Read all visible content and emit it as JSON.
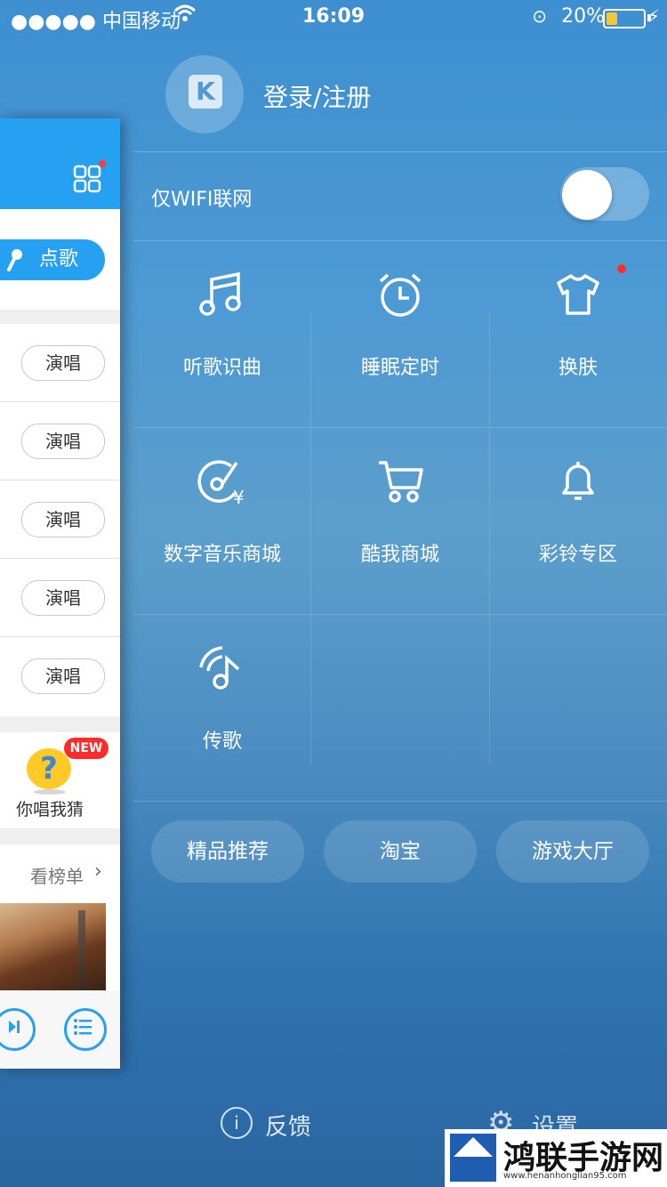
{
  "status_bar": {
    "carrier": "●●●●● 中国移动",
    "time": "16:09",
    "battery": "20%",
    "battery_color": "#f3c93a"
  },
  "header": {
    "login_label": "登录/注册",
    "avatar_letter": "K"
  },
  "wifi_only": {
    "label": "仅WIFI联网",
    "enabled": false
  },
  "grid": [
    {
      "label": "听歌识曲",
      "icon": "music-note-icon"
    },
    {
      "label": "睡眠定时",
      "icon": "alarm-clock-icon"
    },
    {
      "label": "换肤",
      "icon": "tshirt-icon",
      "badge": true
    },
    {
      "label": "数字音乐商城",
      "icon": "music-disc-yen-icon"
    },
    {
      "label": "酷我商城",
      "icon": "shopping-cart-icon"
    },
    {
      "label": "彩铃专区",
      "icon": "bell-icon"
    },
    {
      "label": "传歌",
      "icon": "wireless-music-icon"
    }
  ],
  "pills": [
    "精品推荐",
    "淘宝",
    "游戏大厅"
  ],
  "footer": {
    "feedback": "反馈",
    "settings": "设置"
  },
  "drawer": {
    "song_button": "点歌",
    "sing_label": "演唱",
    "new_badge": "NEW",
    "guess_label": "你唱我猜",
    "rank_label": "看榜单",
    "accent": "#26a0f0"
  },
  "watermark": {
    "title": "鸿联手游网",
    "url": "www.henanhonglian95.com"
  }
}
